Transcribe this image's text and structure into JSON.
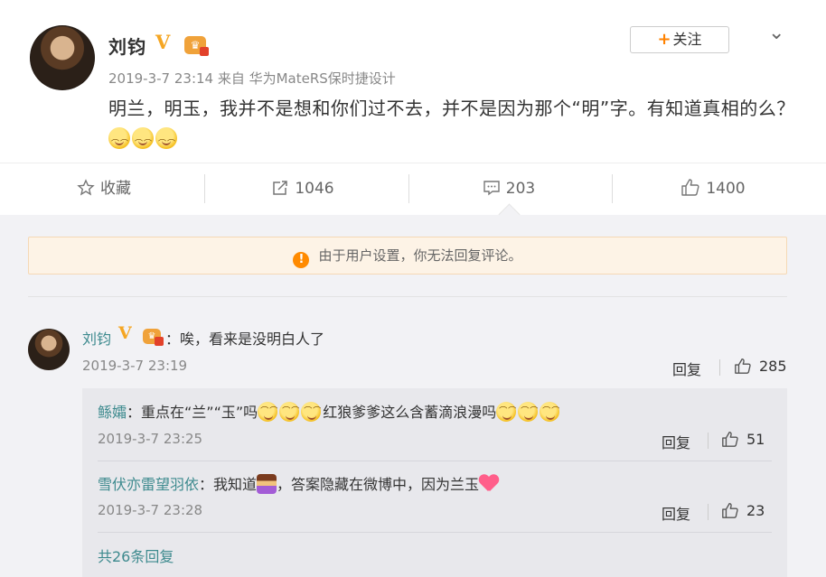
{
  "post": {
    "author": "刘钧",
    "vip_badge": "V",
    "meta": "2019-3-7 23:14 来自 华为MateRS保时捷设计",
    "text": "明兰，明玉，我并不是想和你们过不去，并不是因为那个“明”字。有知道真相的么？",
    "follow_label": "关注",
    "follow_plus": "+"
  },
  "actions": {
    "favorite": "收藏",
    "repost_count": "1046",
    "comment_count": "203",
    "like_count": "1400"
  },
  "notice": {
    "text": "由于用户设置，你无法回复评论。",
    "icon": "warning-icon"
  },
  "comments": [
    {
      "user": "刘钧",
      "text": "：唉，看来是没明白人了",
      "time": "2019-3-7 23:19",
      "reply_label": "回复",
      "likes": "285"
    }
  ],
  "replies": [
    {
      "user": "鲧孀",
      "text_a": "：重点在“兰”“玉”吗",
      "text_b": "红狼爹爹这么含蓄滴浪漫吗",
      "time": "2019-3-7 23:25",
      "reply_label": "回复",
      "likes": "51"
    },
    {
      "user": "雪伏亦雷望羽依",
      "text_a": "：我知道",
      "text_b": "，答案隐藏在微博中，因为兰玉",
      "time": "2019-3-7 23:28",
      "reply_label": "回复",
      "likes": "23"
    }
  ],
  "more_replies": "共26条回复",
  "colors": {
    "accent_orange": "#ff8200",
    "username_teal": "#3d8a8e",
    "vip_gold": "#f5a623"
  }
}
